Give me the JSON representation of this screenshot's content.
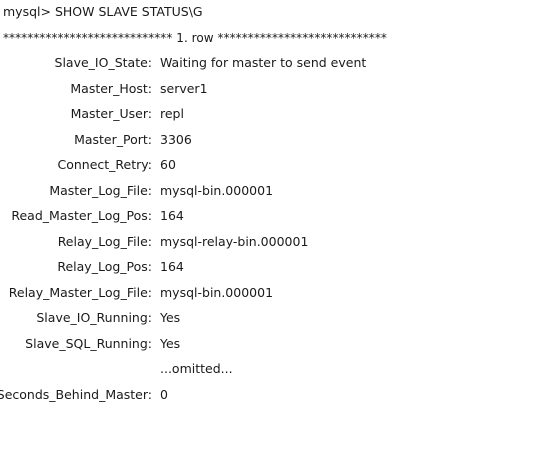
{
  "command": "mysql> SHOW SLAVE STATUS\\G",
  "row_header": "**************************** 1. row ****************************",
  "fields": [
    {
      "name": "Slave_IO_State:",
      "value": "Waiting for master to send event"
    },
    {
      "name": "Master_Host:",
      "value": "server1"
    },
    {
      "name": "Master_User:",
      "value": "repl"
    },
    {
      "name": "Master_Port:",
      "value": "3306"
    },
    {
      "name": "Connect_Retry:",
      "value": "60"
    },
    {
      "name": "Master_Log_File:",
      "value": "mysql-bin.000001"
    },
    {
      "name": "Read_Master_Log_Pos:",
      "value": "164"
    },
    {
      "name": "Relay_Log_File:",
      "value": "mysql-relay-bin.000001"
    },
    {
      "name": "Relay_Log_Pos:",
      "value": "164"
    },
    {
      "name": "Relay_Master_Log_File:",
      "value": "mysql-bin.000001"
    },
    {
      "name": "Slave_IO_Running:",
      "value": "Yes"
    },
    {
      "name": "Slave_SQL_Running:",
      "value": "Yes"
    },
    {
      "name": "Seconds_Behind_Master:",
      "value": "0"
    }
  ],
  "omitted_text": "...omitted..."
}
